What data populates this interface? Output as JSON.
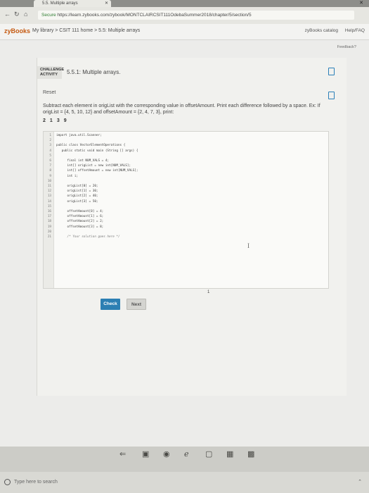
{
  "browser": {
    "tab_title": "5.5. Multiple arrays",
    "tab_close": "✕",
    "window_close": "✕",
    "url_secure": "Secure",
    "url": "https://learn.zybooks.com/zybook/MONTCLAIRCSIT111OdebaSummer2018/chapter/5/section/5"
  },
  "header": {
    "brand": "zyBooks",
    "breadcrumb": "My library > CSIT 111 home > 5.5: Multiple arrays",
    "catalog": "zyBooks catalog",
    "help": "Help/FAQ"
  },
  "feedback": "Feedback?",
  "activity": {
    "pill": "CHALLENGE ACTIVITY",
    "title": "5.5.1: Multiple arrays.",
    "reset": "Reset",
    "instructions": "Subtract each element in origList with the corresponding value in offsetAmount. Print each difference followed by a space. Ex: If origList = {4, 5, 10, 12} and offsetAmount = {2, 4, 7, 3}, print:",
    "output_example": [
      "2",
      "1",
      "3",
      "9"
    ],
    "code_lines": [
      {
        "n": "1",
        "t": "import java.util.Scanner;"
      },
      {
        "n": "2",
        "t": ""
      },
      {
        "n": "3",
        "t": "public class VectorElementOperations {"
      },
      {
        "n": "4",
        "t": "   public static void main (String [] args) {"
      },
      {
        "n": "5",
        "t": ""
      },
      {
        "n": "6",
        "t": "      final int NUM_VALS = 4;"
      },
      {
        "n": "7",
        "t": "      int[] origList = new int[NUM_VALS];"
      },
      {
        "n": "8",
        "t": "      int[] offsetAmount = new int[NUM_VALS];"
      },
      {
        "n": "9",
        "t": "      int i;"
      },
      {
        "n": "10",
        "t": ""
      },
      {
        "n": "11",
        "t": "      origList[0] = 20;"
      },
      {
        "n": "12",
        "t": "      origList[1] = 30;"
      },
      {
        "n": "13",
        "t": "      origList[2] = 40;"
      },
      {
        "n": "14",
        "t": "      origList[3] = 50;"
      },
      {
        "n": "15",
        "t": ""
      },
      {
        "n": "16",
        "t": "      offsetAmount[0] = 4;"
      },
      {
        "n": "17",
        "t": "      offsetAmount[1] = 6;"
      },
      {
        "n": "18",
        "t": "      offsetAmount[2] = 2;"
      },
      {
        "n": "19",
        "t": "      offsetAmount[3] = 8;"
      },
      {
        "n": "20",
        "t": ""
      },
      {
        "n": "21",
        "t": "      /* Your solution goes here */"
      }
    ],
    "cursor": "I",
    "step_counter": "1",
    "check_label": "Check",
    "next_label": "Next"
  },
  "taskbar": {
    "search_placeholder": "Type here to search"
  },
  "colors": {
    "brand": "#c55a11",
    "check_button": "#2c7fb3",
    "badge_outline": "#2a7fb8"
  }
}
